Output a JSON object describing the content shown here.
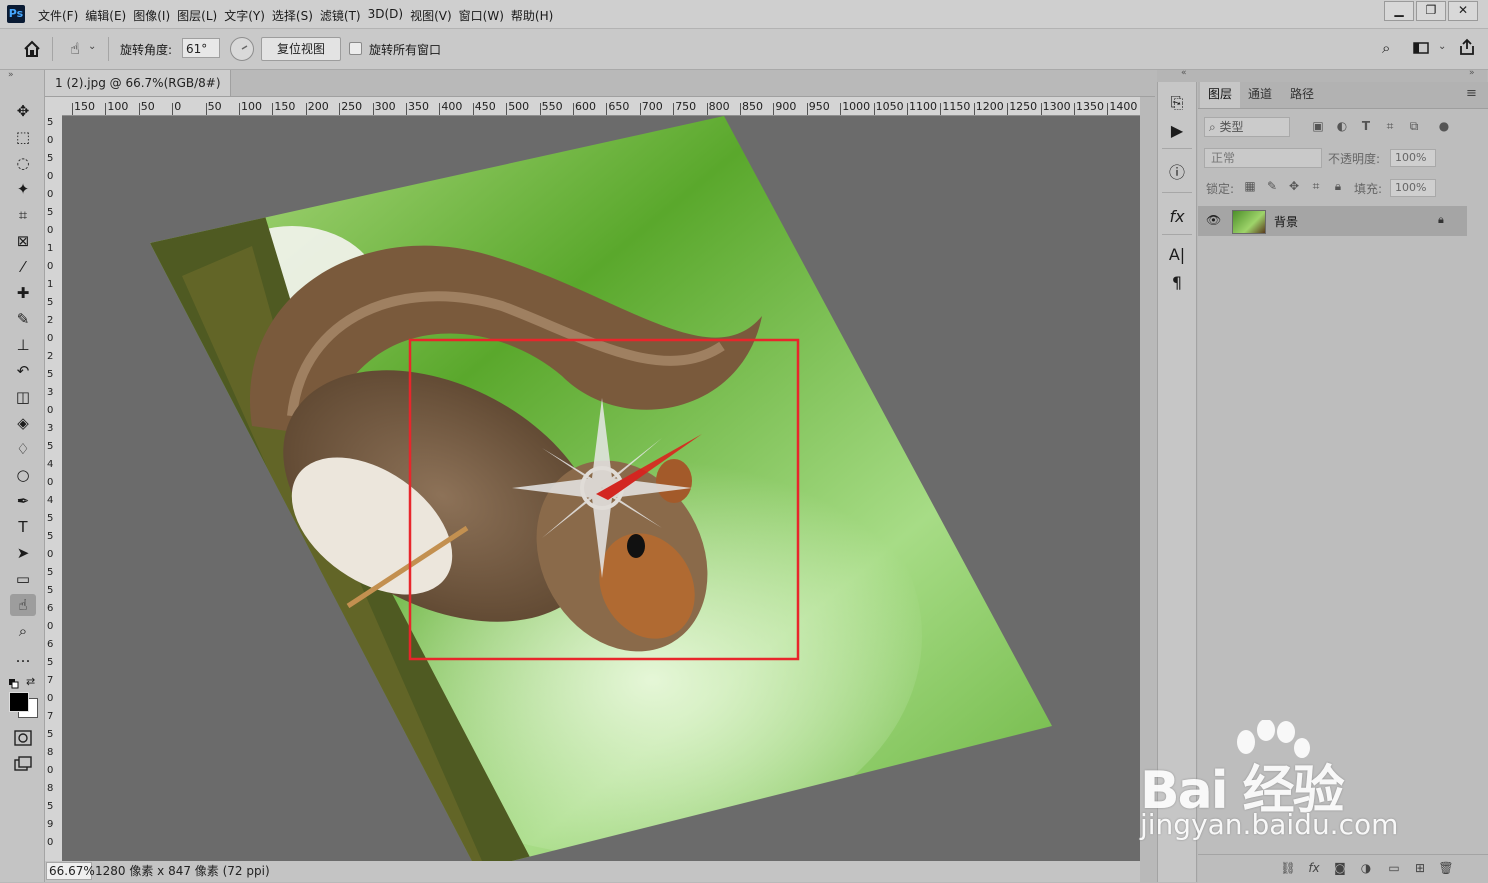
{
  "app": {
    "logo": "Ps"
  },
  "menu": [
    "文件(F)",
    "编辑(E)",
    "图像(I)",
    "图层(L)",
    "文字(Y)",
    "选择(S)",
    "滤镜(T)",
    "3D(D)",
    "视图(V)",
    "窗口(W)",
    "帮助(H)"
  ],
  "window_controls": {
    "minimize": "▁",
    "restore": "❐",
    "close": "✕"
  },
  "options": {
    "rotate_label": "旋转角度:",
    "rotate_value": "61°",
    "reset_label": "复位视图",
    "rotate_all_label": "旋转所有窗口",
    "rotate_all_checked": false
  },
  "document": {
    "tab_title": "1 (2).jpg @ 66.7%(RGB/8#)",
    "tab_close": "×"
  },
  "ruler": {
    "h_ticks": [
      "150",
      "100",
      "50",
      "0",
      "50",
      "100",
      "150",
      "200",
      "250",
      "300",
      "350",
      "400",
      "450",
      "500",
      "550",
      "600",
      "650",
      "700",
      "750",
      "800",
      "850",
      "900",
      "950",
      "1000",
      "1050",
      "1100",
      "1150",
      "1200",
      "1250",
      "1300",
      "1350",
      "1400"
    ],
    "v_ticks": [
      "5",
      "0",
      "5",
      "0",
      "0",
      "5",
      "0",
      "1",
      "0",
      "1",
      "5",
      "2",
      "0",
      "2",
      "5",
      "3",
      "0",
      "3",
      "5",
      "4",
      "0",
      "4",
      "5",
      "5",
      "0",
      "5",
      "5",
      "6",
      "0",
      "6",
      "5",
      "7",
      "0",
      "7",
      "5",
      "8",
      "0",
      "8",
      "5",
      "9",
      "0"
    ]
  },
  "status": {
    "zoom": "66.67%",
    "info": "1280 像素 x 847 像素 (72 ppi)"
  },
  "tools": [
    {
      "name": "move-tool",
      "glyph": "✥"
    },
    {
      "name": "marquee-tool",
      "glyph": "⬚"
    },
    {
      "name": "lasso-tool",
      "glyph": "◌"
    },
    {
      "name": "magic-wand-tool",
      "glyph": "✦"
    },
    {
      "name": "crop-tool",
      "glyph": "⌗"
    },
    {
      "name": "frame-tool",
      "glyph": "⊠"
    },
    {
      "name": "eyedropper-tool",
      "glyph": "⁄"
    },
    {
      "name": "healing-brush-tool",
      "glyph": "✚"
    },
    {
      "name": "brush-tool",
      "glyph": "✎"
    },
    {
      "name": "stamp-tool",
      "glyph": "⊥"
    },
    {
      "name": "history-brush-tool",
      "glyph": "↶"
    },
    {
      "name": "eraser-tool",
      "glyph": "◫"
    },
    {
      "name": "paint-bucket-tool",
      "glyph": "◈"
    },
    {
      "name": "blur-tool",
      "glyph": "♢"
    },
    {
      "name": "dodge-tool",
      "glyph": "○"
    },
    {
      "name": "pen-tool",
      "glyph": "✒"
    },
    {
      "name": "type-tool",
      "glyph": "T"
    },
    {
      "name": "path-selection-tool",
      "glyph": "➤"
    },
    {
      "name": "rectangle-tool",
      "glyph": "▭"
    },
    {
      "name": "rotate-view-tool",
      "glyph": "☝",
      "active": true
    },
    {
      "name": "zoom-tool",
      "glyph": "⌕"
    },
    {
      "name": "more-tools",
      "glyph": "…"
    }
  ],
  "right_mini_panel": [
    "history-icon",
    "play-icon",
    "info-icon",
    "fx-icon",
    "character-icon",
    "paragraph-icon"
  ],
  "layers_panel": {
    "tabs": [
      "图层",
      "通道",
      "路径"
    ],
    "active_tab": 0,
    "filter_label": "类型",
    "blend_mode": "正常",
    "opacity_label": "不透明度:",
    "opacity_value": "100%",
    "lock_label": "锁定:",
    "fill_label": "填充:",
    "fill_value": "100%",
    "layers": [
      {
        "name": "背景",
        "visible": true,
        "locked": true
      }
    ]
  },
  "watermark": {
    "brand": "Bai 经验",
    "url": "jingyan.baidu.com"
  },
  "colors": {
    "highlight_box": "#e8262b",
    "canvas_bg": "#6b6b6b",
    "compass_needle": "#e01b1b"
  }
}
